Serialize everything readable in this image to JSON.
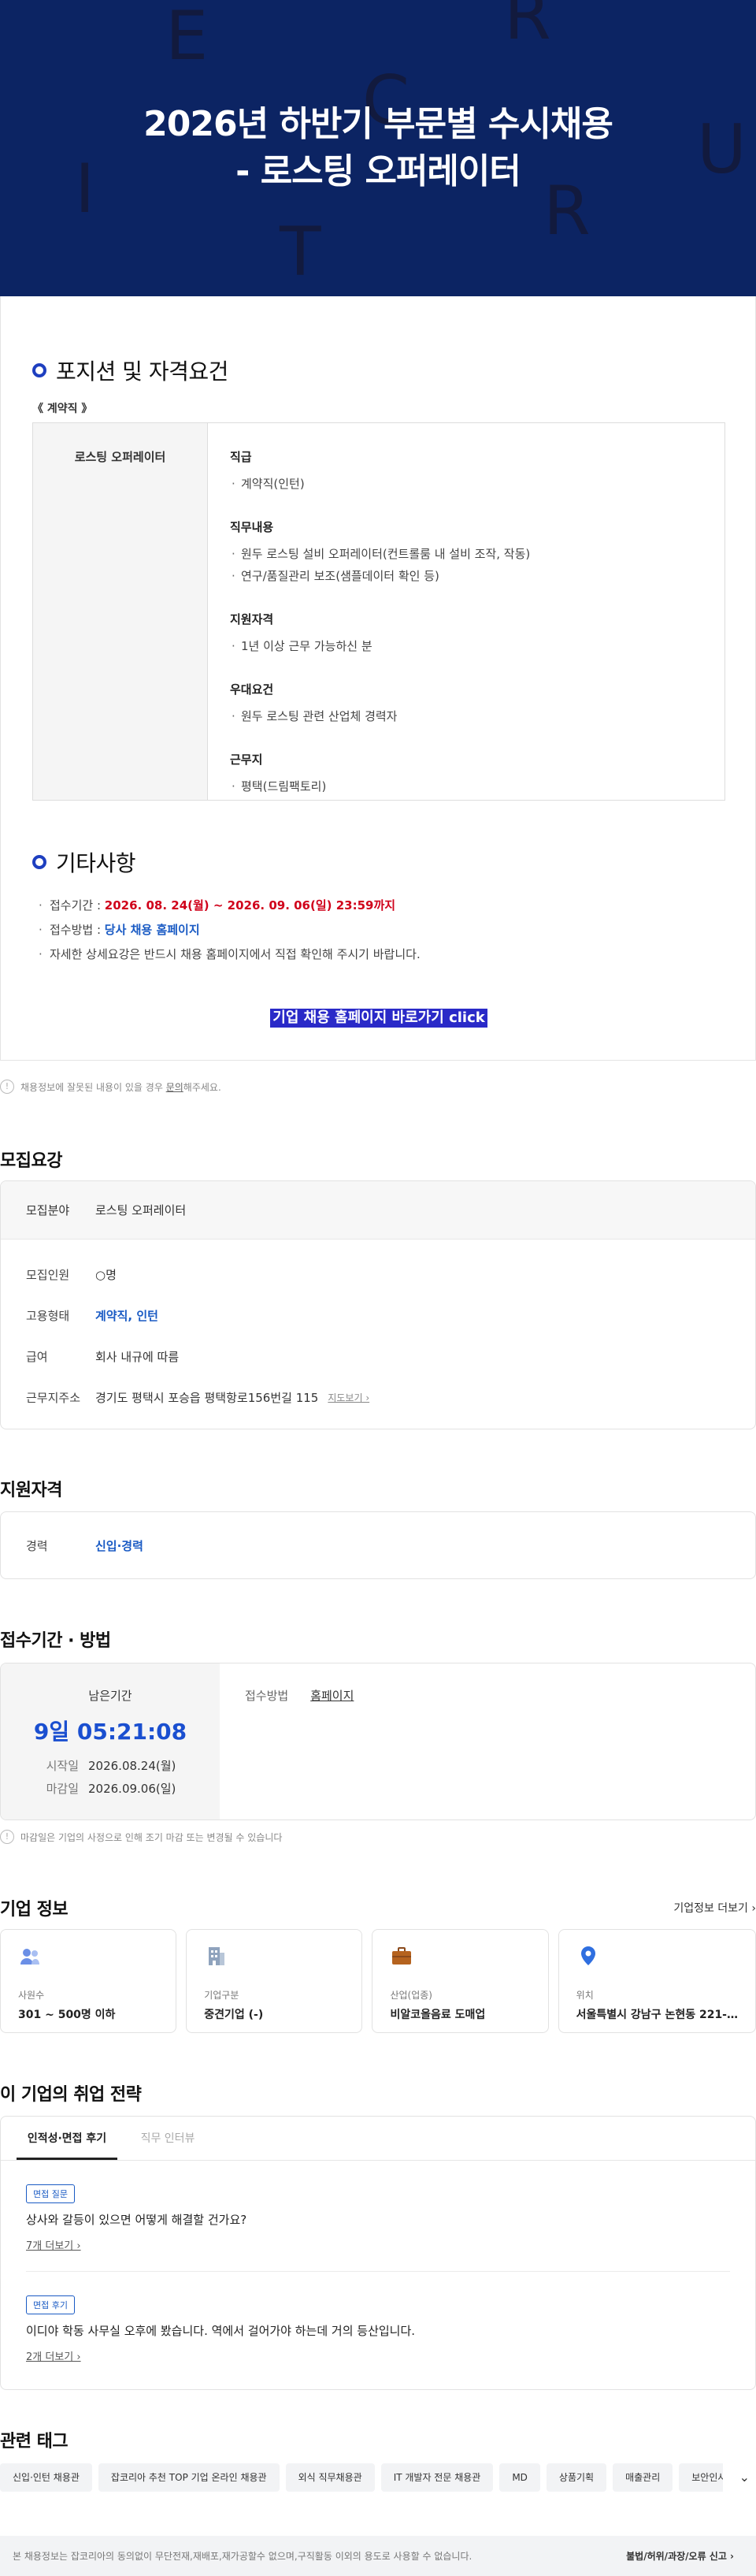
{
  "banner": {
    "line1": "2026년 하반기 부문별 수시채용",
    "line2": "- 로스팅 오퍼레이터",
    "letters": [
      "E",
      "R",
      "C",
      "U",
      "I",
      "R",
      "T"
    ]
  },
  "jd": {
    "section1_title": "포지션 및 자격요건",
    "contract_tag": "《 계약직 》",
    "position": "로스팅 오퍼레이터",
    "blocks": [
      {
        "h": "직급",
        "items": [
          "계약직(인턴)"
        ]
      },
      {
        "h": "직무내용",
        "items": [
          "원두 로스팅 설비 오퍼레이터(컨트롤룸 내 설비 조작, 작동)",
          "연구/품질관리 보조(샘플데이터 확인 등)"
        ]
      },
      {
        "h": "지원자격",
        "items": [
          "1년 이상 근무 가능하신 분"
        ]
      },
      {
        "h": "우대요건",
        "items": [
          "원두 로스팅 관련 산업체 경력자"
        ]
      },
      {
        "h": "근무지",
        "items": [
          "평택(드림팩토리)"
        ]
      }
    ],
    "section2_title": "기타사항",
    "period_label": "접수기간 : ",
    "period_value": "2026. 08. 24(월) ~ 2026. 09. 06(일) 23:59까지",
    "method_label": "접수방법 : ",
    "method_value": "당사 채용 홈페이지",
    "detail": "자세한 상세요강은 반드시 채용 홈페이지에서 직접 확인해 주시기 바랍니다.",
    "cta": "기업 채용 홈페이지 바로가기 click"
  },
  "notice1": {
    "pre": "채용정보에 잘못된 내용이 있을 경우 ",
    "link": "문의",
    "post": "해주세요."
  },
  "recruit": {
    "title": "모집요강",
    "field_k": "모집분야",
    "field_v": "로스팅 오퍼레이터",
    "rows": [
      {
        "k": "모집인원",
        "v": "○명"
      },
      {
        "k": "고용형태",
        "v": "계약직, 인턴"
      },
      {
        "k": "급여",
        "v": "회사 내규에 따름"
      },
      {
        "k": "근무지주소",
        "v": "경기도 평택시 포승읍 평택항로156번길 115"
      }
    ],
    "map": "지도보기 ›"
  },
  "qual": {
    "title": "지원자격",
    "k": "경력",
    "v": "신입·경력"
  },
  "period": {
    "title": "접수기간 · 방법",
    "remain_k": "남은기간",
    "remain_v": "9일 05:21:08",
    "start_k": "시작일",
    "start_v": "2026.08.24(월)",
    "end_k": "마감일",
    "end_v": "2026.09.06(일)",
    "method_k": "접수방법",
    "method_v": "홈페이지"
  },
  "notice2": "마감일은 기업의 사정으로 인해 조기 마감 또는 변경될 수 있습니다",
  "company": {
    "title": "기업 정보",
    "more": "기업정보 더보기 ›",
    "cards": [
      {
        "k": "사원수",
        "v": "301 ~ 500명 이하",
        "icon": "people-icon"
      },
      {
        "k": "기업구분",
        "v": "중견기업 (-)",
        "icon": "building-icon"
      },
      {
        "k": "산업(업종)",
        "v": "비알코올음료 도매업",
        "icon": "briefcase-icon"
      },
      {
        "k": "위치",
        "v": "서울특별시 강남구 논현동 221-…",
        "icon": "location-pin-icon"
      }
    ]
  },
  "strategy": {
    "title": "이 기업의 취업 전략",
    "tab1": "인적성·면접 후기",
    "tab2": "직무 인터뷰",
    "items": [
      {
        "badge": "면접 질문",
        "q": "상사와 갈등이 있으면 어떻게 해결할 건가요?",
        "more": "7개 더보기 ›"
      },
      {
        "badge": "면접 후기",
        "q": "이디야 학동 사무실 오후에 봤습니다. 역에서 걸어가야 하는데 거의 등산입니다.",
        "more": "2개 더보기 ›"
      }
    ]
  },
  "tags": {
    "title": "관련 태그",
    "items": [
      "신입·인턴 채용관",
      "잡코리아 추천 TOP 기업 온라인 채용관",
      "외식 직무채용관",
      "IT 개발자 전문 채용관",
      "MD",
      "상품기획",
      "매출관리",
      "보안인사"
    ]
  },
  "footer": {
    "left": "본 채용정보는 잡코리아의 동의없이 무단전재,재배포,재가공할수 없으며,구직활동 이외의 용도로 사용할 수 없습니다.",
    "right": "불법/허위/과장/오류 신고 ›"
  },
  "colors": {
    "banner": "#0c2463",
    "accent": "#1e3fc0",
    "link_blue": "#1a5bc4",
    "red": "#d0021b",
    "cta": "#2a2ac8"
  }
}
